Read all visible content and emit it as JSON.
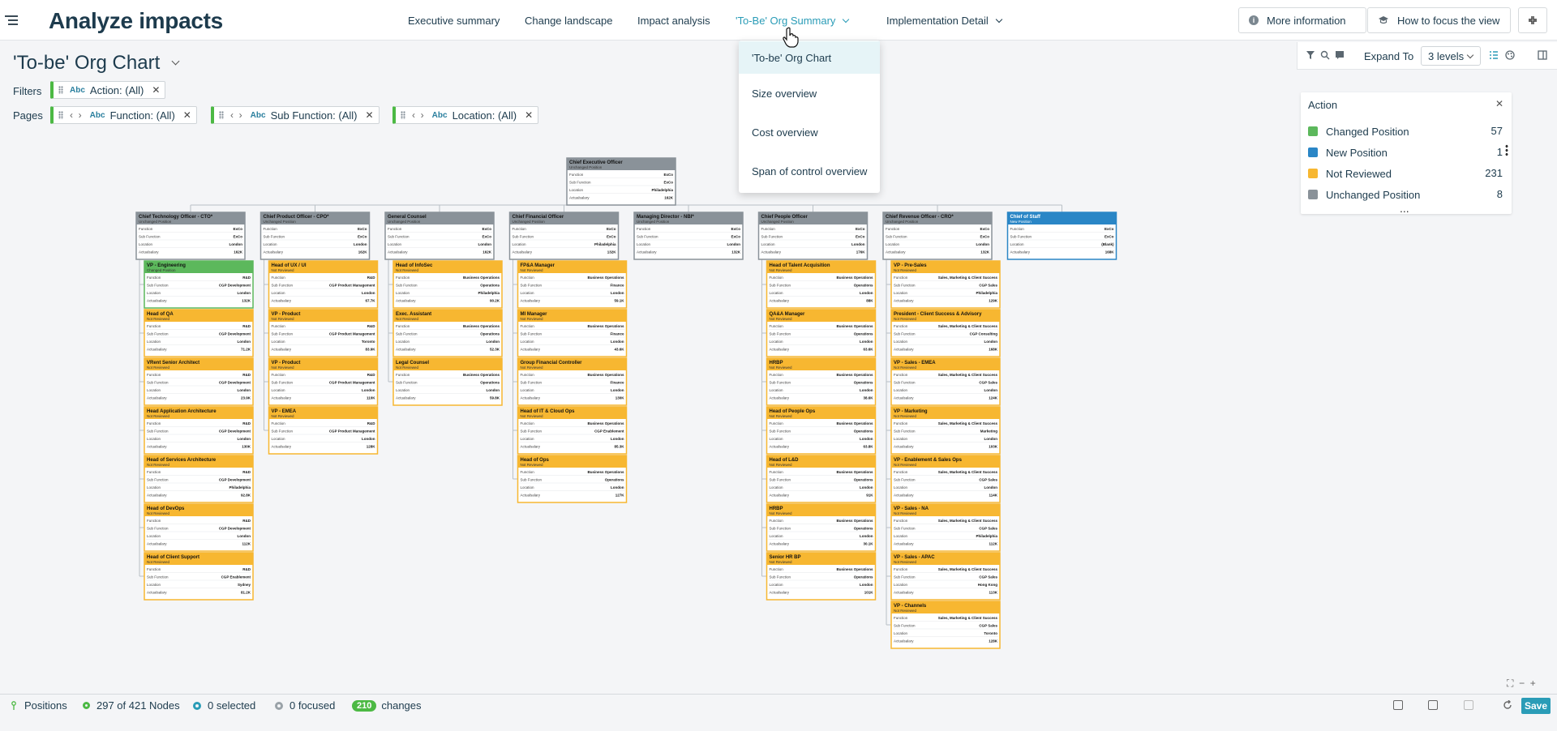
{
  "app": {
    "title": "Analyze impacts"
  },
  "nav": {
    "tabs": [
      {
        "label": "Executive summary"
      },
      {
        "label": "Change landscape"
      },
      {
        "label": "Impact analysis"
      },
      {
        "label": "'To-Be' Org Summary"
      },
      {
        "label": "Implementation Detail"
      }
    ]
  },
  "toolbar": {
    "more_info": "More information",
    "how_to": "How to focus the view"
  },
  "dropdown": {
    "items": [
      {
        "label": "'To-be' Org Chart"
      },
      {
        "label": "Size overview"
      },
      {
        "label": "Cost overview"
      },
      {
        "label": "Span of control overview"
      }
    ]
  },
  "page": {
    "title": "'To-be' Org Chart"
  },
  "filters": {
    "label": "Filters",
    "items": [
      {
        "text": "Action: (All)"
      }
    ]
  },
  "pages": {
    "label": "Pages",
    "items": [
      {
        "text": "Function: (All)"
      },
      {
        "text": "Sub Function: (All)"
      },
      {
        "text": "Location: (All)"
      }
    ]
  },
  "abc": "Abc",
  "viz_toolbar": {
    "expand_label": "Expand To",
    "expand_value": "3 levels"
  },
  "legend": {
    "title": "Action",
    "items": [
      {
        "label": "Changed Position",
        "count": "57",
        "color": "#5cb85c"
      },
      {
        "label": "New Position",
        "count": "1",
        "color": "#2a86c6"
      },
      {
        "label": "Not Reviewed",
        "count": "231",
        "color": "#f7b731"
      },
      {
        "label": "Unchanged Position",
        "count": "8",
        "color": "#8a9299"
      }
    ]
  },
  "card_fields": [
    "Function",
    "Sub Function",
    "Location",
    "Actualsalary"
  ],
  "org": {
    "root": {
      "title": "Chief Executive Officer",
      "status": "Unchanged Position",
      "action": "unchanged",
      "fields": [
        "ExCo",
        "ExCo",
        "Philadelphia",
        "162K"
      ]
    },
    "columns": [
      {
        "head": {
          "title": "Chief Technology Officer - CTO*",
          "status": "Unchanged Position",
          "action": "unchanged",
          "fields": [
            "ExCo",
            "ExCo",
            "London",
            "162K"
          ]
        },
        "children": [
          {
            "title": "VP - Engineering",
            "status": "Changed Position",
            "action": "changed",
            "fields": [
              "R&D",
              "CGP Development",
              "London",
              "132K"
            ]
          },
          {
            "title": "Head of QA",
            "status": "Not Reviewed",
            "action": "notreviewed",
            "fields": [
              "R&D",
              "CGP Development",
              "London",
              "71.2K"
            ]
          },
          {
            "title": "VRent Senior Architect",
            "status": "Not Reviewed",
            "action": "notreviewed",
            "fields": [
              "R&D",
              "CGP Development",
              "London",
              "23.9K"
            ]
          },
          {
            "title": "Head Application Architecture",
            "status": "Not Reviewed",
            "action": "notreviewed",
            "fields": [
              "R&D",
              "CGP Development",
              "London",
              "130K"
            ]
          },
          {
            "title": "Head of Services Architecture",
            "status": "Not Reviewed",
            "action": "notreviewed",
            "fields": [
              "R&D",
              "CGP Development",
              "Philadelphia",
              "92.8K"
            ]
          },
          {
            "title": "Head of DevOps",
            "status": "Not Reviewed",
            "action": "notreviewed",
            "fields": [
              "R&D",
              "CGP Development",
              "London",
              "112K"
            ]
          },
          {
            "title": "Head of Client Support",
            "status": "Not Reviewed",
            "action": "notreviewed",
            "fields": [
              "R&D",
              "CGP Enablement",
              "Sydney",
              "81.2K"
            ]
          }
        ]
      },
      {
        "head": {
          "title": "Chief Product Officer - CPO*",
          "status": "Unchanged Position",
          "action": "unchanged",
          "fields": [
            "ExCo",
            "ExCo",
            "London",
            "162K"
          ]
        },
        "children": [
          {
            "title": "Head of UX / UI",
            "status": "Not Reviewed",
            "action": "notreviewed",
            "fields": [
              "R&D",
              "CGP Product Management",
              "London",
              "67.7K"
            ]
          },
          {
            "title": "VP - Product",
            "status": "Not Reviewed",
            "action": "notreviewed",
            "fields": [
              "R&D",
              "CGP Product Management",
              "Toronto",
              "83.9K"
            ]
          },
          {
            "title": "VP - Product",
            "status": "Not Reviewed",
            "action": "notreviewed",
            "fields": [
              "R&D",
              "CGP Product Management",
              "London",
              "110K"
            ]
          },
          {
            "title": "VP - EMEA",
            "status": "Not Reviewed",
            "action": "notreviewed",
            "fields": [
              "R&D",
              "CGP Product Management",
              "London",
              "128K"
            ]
          }
        ]
      },
      {
        "head": {
          "title": "General Counsel",
          "status": "Unchanged Position",
          "action": "unchanged",
          "fields": [
            "ExCo",
            "ExCo",
            "London",
            "162K"
          ]
        },
        "children": [
          {
            "title": "Head of InfoSec",
            "status": "Not Reviewed",
            "action": "notreviewed",
            "fields": [
              "Business Operations",
              "Operations",
              "Philadelphia",
              "90.2K"
            ]
          },
          {
            "title": "Exec. Assistant",
            "status": "Not Reviewed",
            "action": "notreviewed",
            "fields": [
              "Business Operations",
              "Operations",
              "London",
              "52.3K"
            ]
          },
          {
            "title": "Legal Counsel",
            "status": "Not Reviewed",
            "action": "notreviewed",
            "fields": [
              "Business Operations",
              "Operations",
              "London",
              "59.8K"
            ]
          }
        ]
      },
      {
        "head": {
          "title": "Chief Financial Officer",
          "status": "Unchanged Position",
          "action": "unchanged",
          "fields": [
            "ExCo",
            "ExCo",
            "Philadelphia",
            "132K"
          ]
        },
        "children": [
          {
            "title": "FP&A Manager",
            "status": "Not Reviewed",
            "action": "notreviewed",
            "fields": [
              "Business Operations",
              "Finance",
              "London",
              "59.1K"
            ]
          },
          {
            "title": "MI Manager",
            "status": "Not Reviewed",
            "action": "notreviewed",
            "fields": [
              "Business Operations",
              "Finance",
              "London",
              "43.6K"
            ]
          },
          {
            "title": "Group Financial Controller",
            "status": "Not Reviewed",
            "action": "notreviewed",
            "fields": [
              "Business Operations",
              "Finance",
              "London",
              "130K"
            ]
          },
          {
            "title": "Head of IT & Cloud Ops",
            "status": "Not Reviewed",
            "action": "notreviewed",
            "fields": [
              "Business Operations",
              "CGP Enablement",
              "London",
              "85.3K"
            ]
          },
          {
            "title": "Head of Ops",
            "status": "Not Reviewed",
            "action": "notreviewed",
            "fields": [
              "Business Operations",
              "Operations",
              "London",
              "127K"
            ]
          }
        ]
      },
      {
        "head": {
          "title": "Managing Director - NBI*",
          "status": "Unchanged Position",
          "action": "unchanged",
          "fields": [
            "ExCo",
            "ExCo",
            "London",
            "132K"
          ]
        },
        "children": []
      },
      {
        "head": {
          "title": "Chief People Officer",
          "status": "Unchanged Position",
          "action": "unchanged",
          "fields": [
            "ExCo",
            "ExCo",
            "London",
            "176K"
          ]
        },
        "children": [
          {
            "title": "Head of Talent Acquisition",
            "status": "Not Reviewed",
            "action": "notreviewed",
            "fields": [
              "Business Operations",
              "Operations",
              "London",
              "88K"
            ]
          },
          {
            "title": "QA&A Manager",
            "status": "Not Reviewed",
            "action": "notreviewed",
            "fields": [
              "Business Operations",
              "Operations",
              "London",
              "63.6K"
            ]
          },
          {
            "title": "HRBP",
            "status": "Not Reviewed",
            "action": "notreviewed",
            "fields": [
              "Business Operations",
              "Operations",
              "London",
              "38.6K"
            ]
          },
          {
            "title": "Head of People Ops",
            "status": "Not Reviewed",
            "action": "notreviewed",
            "fields": [
              "Business Operations",
              "Operations",
              "London",
              "63.8K"
            ]
          },
          {
            "title": "Head of L&D",
            "status": "Not Reviewed",
            "action": "notreviewed",
            "fields": [
              "Business Operations",
              "Operations",
              "London",
              "91K"
            ]
          },
          {
            "title": "HRBP",
            "status": "Not Reviewed",
            "action": "notreviewed",
            "fields": [
              "Business Operations",
              "Operations",
              "London",
              "30.1K"
            ]
          },
          {
            "title": "Senior HR BP",
            "status": "Not Reviewed",
            "action": "notreviewed",
            "fields": [
              "Business Operations",
              "Operations",
              "London",
              "101K"
            ]
          }
        ]
      },
      {
        "head": {
          "title": "Chief Revenue Officer - CRO*",
          "status": "Unchanged Position",
          "action": "unchanged",
          "fields": [
            "ExCo",
            "ExCo",
            "London",
            "132K"
          ]
        },
        "children": [
          {
            "title": "VP - Pre-Sales",
            "status": "Not Reviewed",
            "action": "notreviewed",
            "fields": [
              "Sales, Marketing & Client Success",
              "CGP Sales",
              "Philadelphia",
              "129K"
            ]
          },
          {
            "title": "President - Client Success & Advisory",
            "status": "Not Reviewed",
            "action": "notreviewed",
            "fields": [
              "Sales, Marketing & Client Success",
              "CGP Consulting",
              "London",
              "168K"
            ]
          },
          {
            "title": "VP - Sales - EMEA",
            "status": "Not Reviewed",
            "action": "notreviewed",
            "fields": [
              "Sales, Marketing & Client Success",
              "CGP Sales",
              "London",
              "124K"
            ]
          },
          {
            "title": "VP - Marketing",
            "status": "Not Reviewed",
            "action": "notreviewed",
            "fields": [
              "Sales, Marketing & Client Success",
              "Marketing",
              "London",
              "103K"
            ]
          },
          {
            "title": "VP - Enablement & Sales Ops",
            "status": "Not Reviewed",
            "action": "notreviewed",
            "fields": [
              "Sales, Marketing & Client Success",
              "CGP Sales",
              "London",
              "114K"
            ]
          },
          {
            "title": "VP - Sales - NA",
            "status": "Not Reviewed",
            "action": "notreviewed",
            "fields": [
              "Sales, Marketing & Client Success",
              "CGP Sales",
              "Philadelphia",
              "112K"
            ]
          },
          {
            "title": "VP - Sales - APAC",
            "status": "Not Reviewed",
            "action": "notreviewed",
            "fields": [
              "Sales, Marketing & Client Success",
              "CGP Sales",
              "Hong Kong",
              "113K"
            ]
          },
          {
            "title": "VP - Channels",
            "status": "Not Reviewed",
            "action": "notreviewed",
            "fields": [
              "Sales, Marketing & Client Success",
              "CGP Sales",
              "Toronto",
              "128K"
            ]
          }
        ]
      },
      {
        "head": {
          "title": "Chief of Staff",
          "status": "New Position",
          "action": "new",
          "fields": [
            "ExCo",
            "ExCo",
            "(Blank)",
            "168K"
          ]
        },
        "children": []
      }
    ]
  },
  "status_bar": {
    "positions": "Positions",
    "nodes": "297 of 421 Nodes",
    "selected": "0 selected",
    "focused": "0 focused",
    "changes_count": "210",
    "changes_label": "changes",
    "save": "Save"
  }
}
